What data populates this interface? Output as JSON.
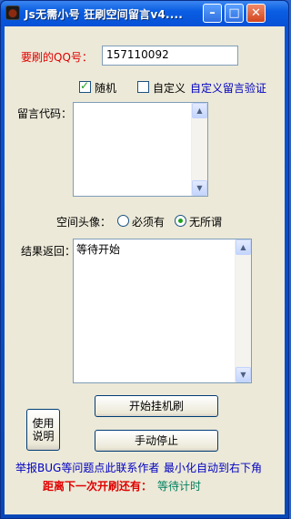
{
  "window": {
    "title": "Js无需小号 狂刷空间留言v4....",
    "min_symbol": "–",
    "max_symbol": "□",
    "close_symbol": "✕"
  },
  "form": {
    "qq_label": "要刷的QQ号：",
    "qq_value": "157110092",
    "random_label": "随机",
    "random_checked": true,
    "custom_label": "自定义",
    "custom_checked": false,
    "custom_verify_link": "自定义留言验证",
    "code_label": "留言代码：",
    "avatar_label": "空间头像：",
    "avatar_option_required": "必须有",
    "avatar_option_any": "无所谓",
    "avatar_selected": "无所谓",
    "result_label": "结果返回：",
    "result_text": "等待开始"
  },
  "buttons": {
    "start": "开始挂机刷",
    "stop": "手动停止",
    "help_line1": "使用",
    "help_line2": "说明"
  },
  "footer": {
    "report_bug": "举报BUG等问题点此联系作者",
    "minimize_tip": "最小化自动到右下角",
    "next_run_label": "距离下一次开刷还有：",
    "next_run_value": "等待计时"
  },
  "colors": {
    "title_bar": "#0b5ee3",
    "client_bg": "#ece9d8",
    "label_red": "#e00000",
    "link_blue": "#0000c0",
    "status_teal": "#008060"
  }
}
